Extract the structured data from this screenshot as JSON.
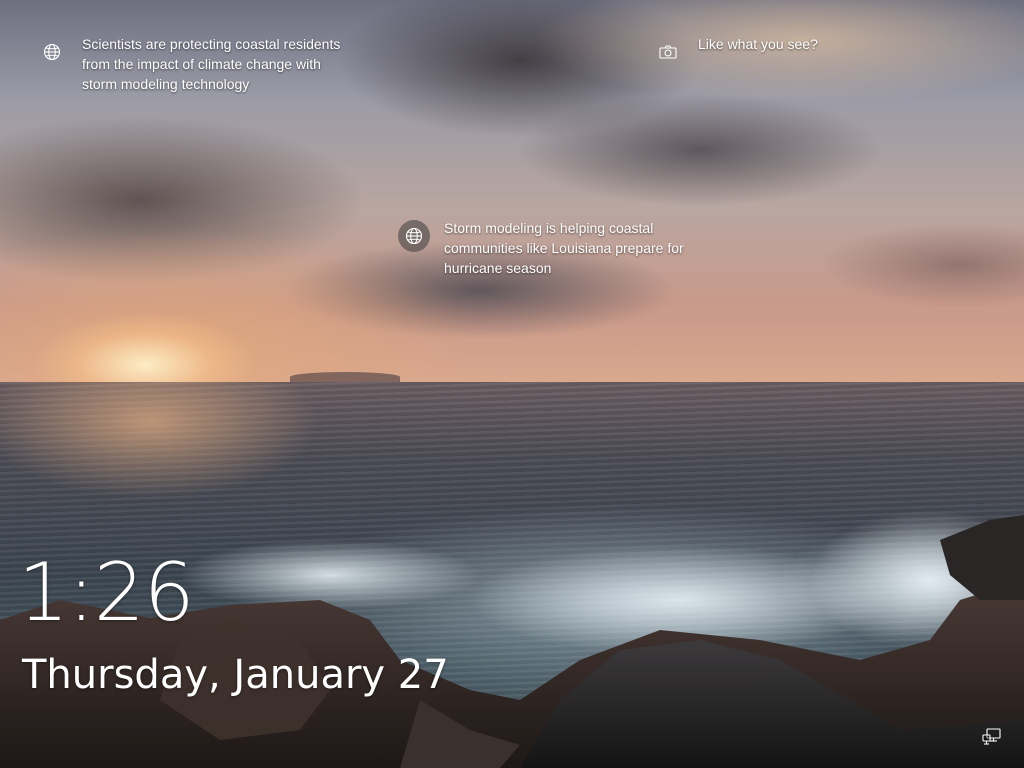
{
  "spotlight": {
    "items": [
      {
        "icon": "globe-icon",
        "text": "Scientists are protecting coastal residents\nfrom the impact of climate change with\nstorm modeling technology"
      },
      {
        "icon": "camera-icon",
        "text": "Like what you see?"
      },
      {
        "icon": "globe-icon",
        "text": "Storm modeling is helping coastal\ncommunities like Louisiana prepare for\nhurricane season"
      }
    ]
  },
  "lock": {
    "time": "1:26",
    "date": "Thursday, January 27"
  },
  "tray": {
    "network_icon": "network-icon"
  },
  "colors": {
    "text": "#ffffff",
    "icon_bg": "rgba(60,60,60,0.55)"
  }
}
